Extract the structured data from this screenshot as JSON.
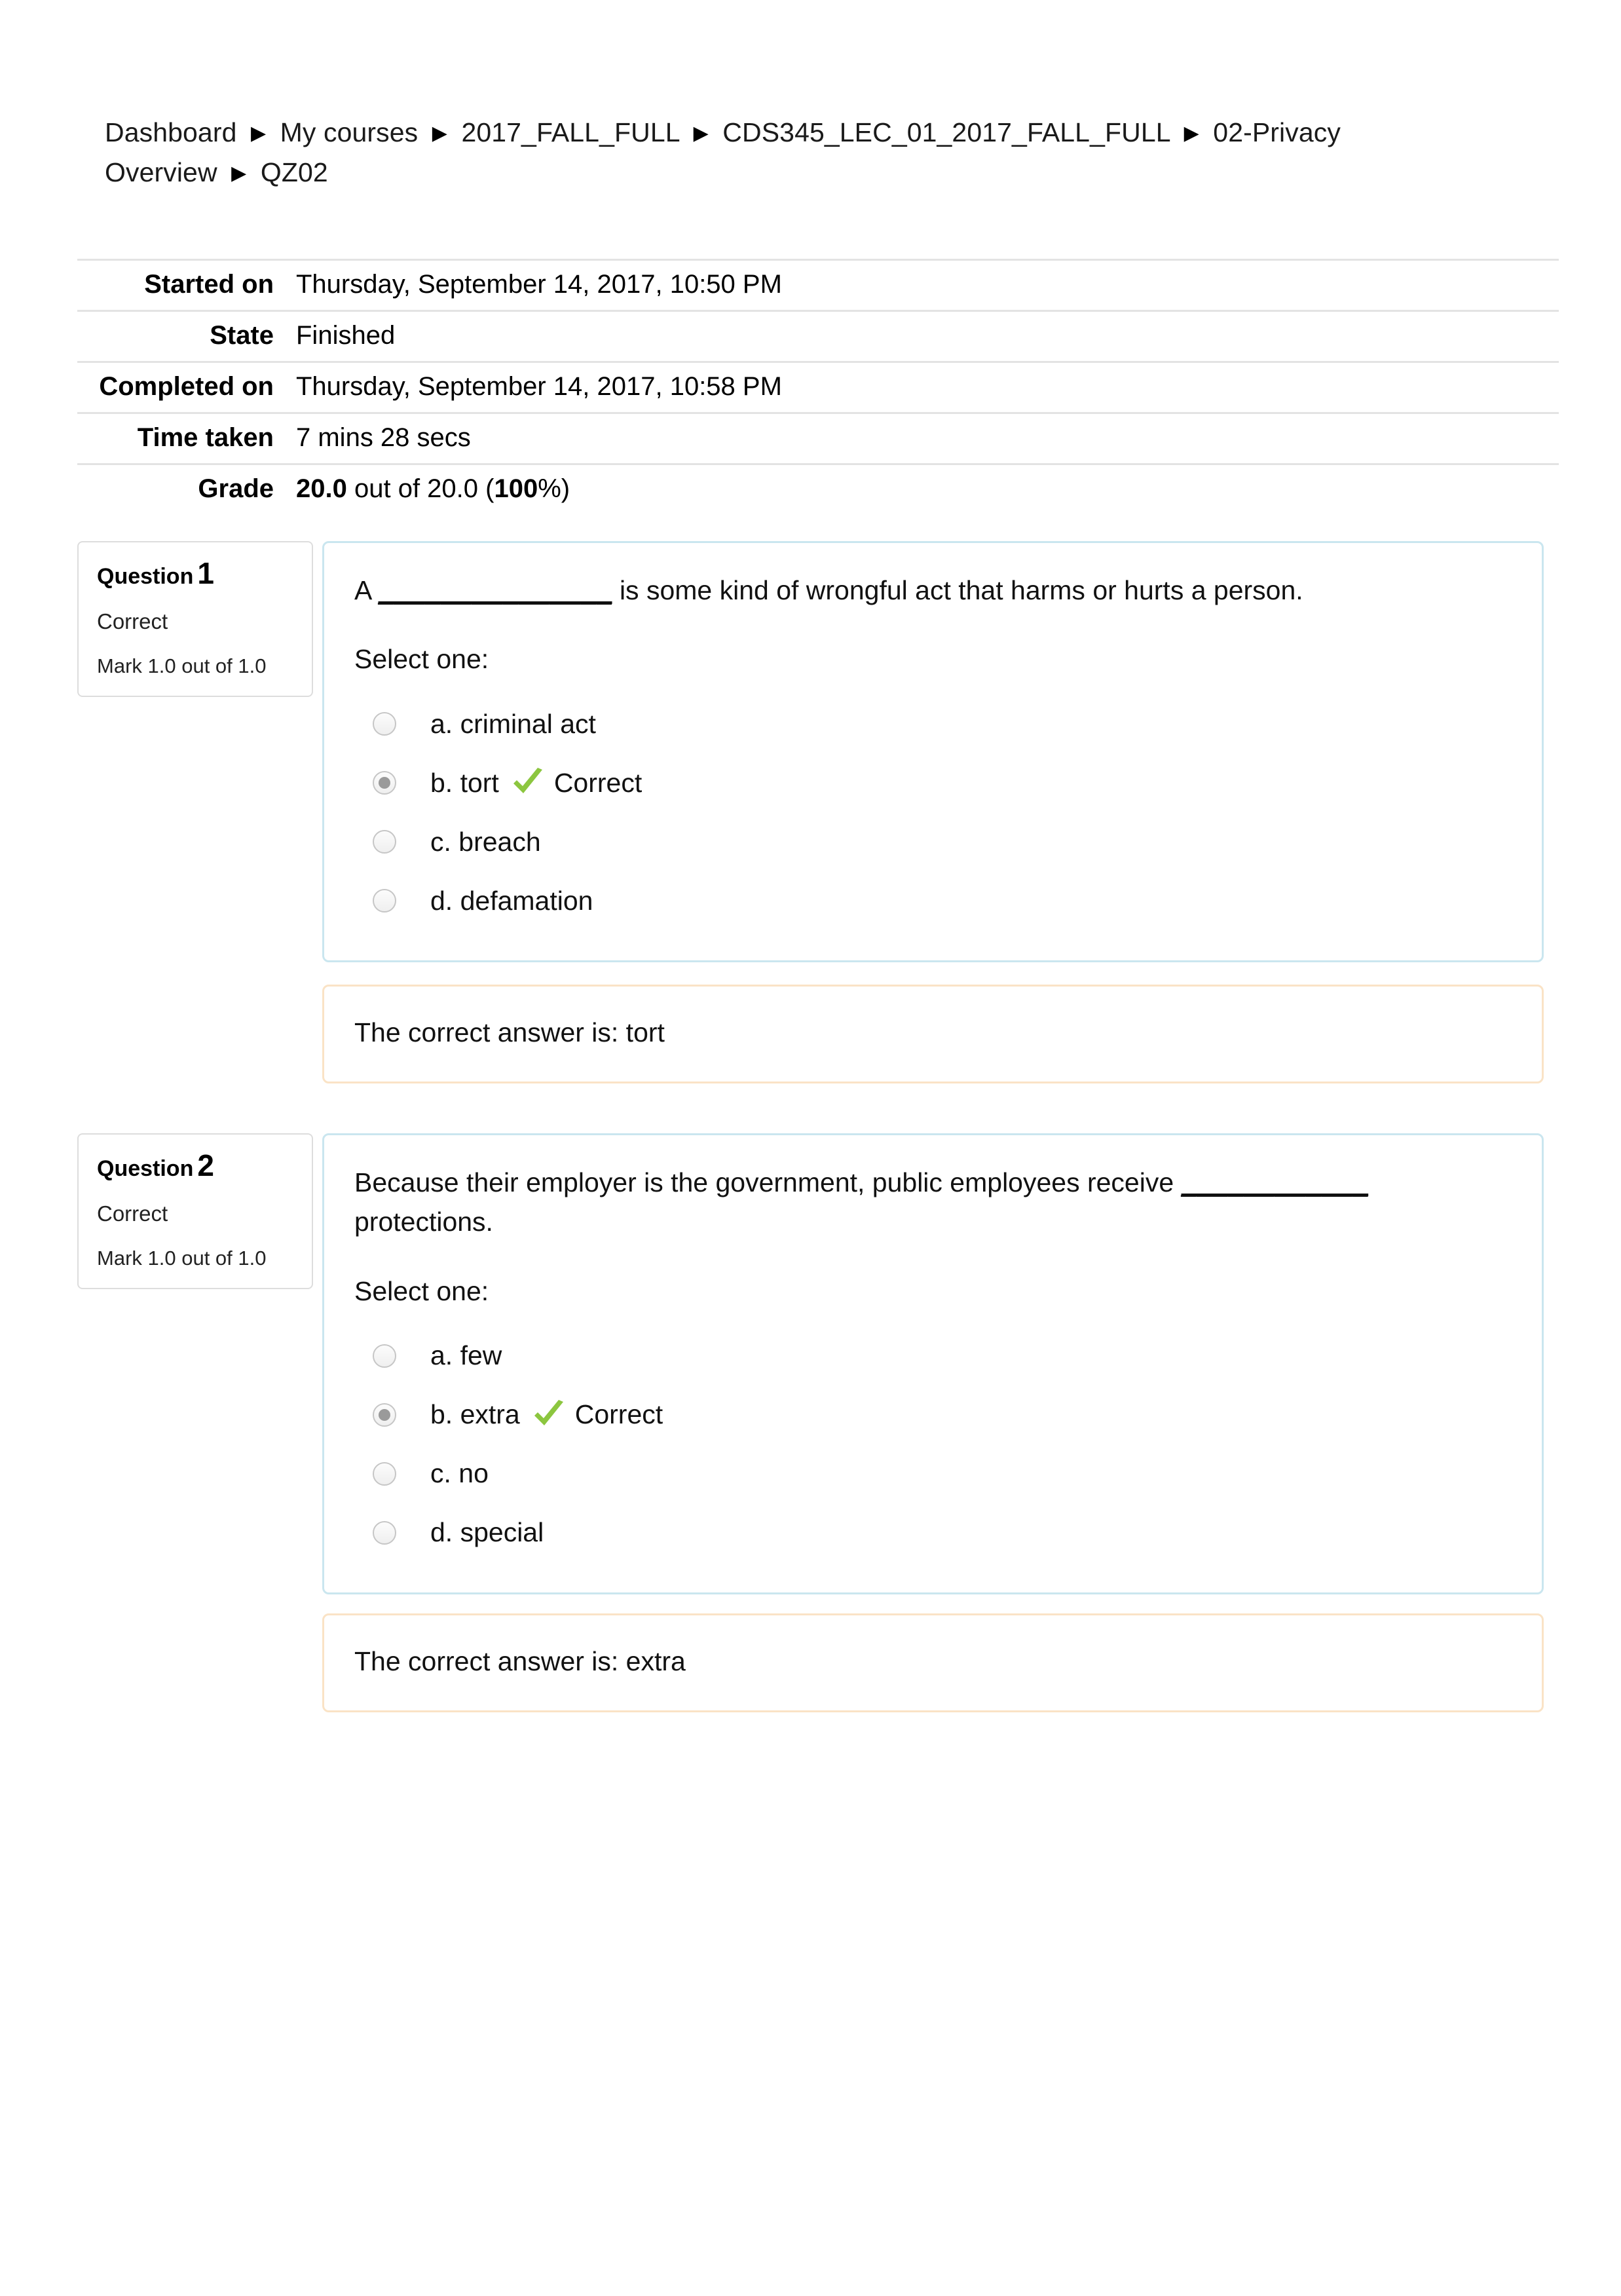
{
  "breadcrumb": {
    "separator": "▶",
    "items": [
      "Dashboard",
      "My courses",
      "2017_FALL_FULL",
      "CDS345_LEC_01_2017_FALL_FULL",
      "02-Privacy Overview",
      "QZ02"
    ]
  },
  "summary": {
    "rows": [
      {
        "label": "Started on",
        "value": "Thursday, September 14, 2017, 10:50 PM"
      },
      {
        "label": "State",
        "value": "Finished"
      },
      {
        "label": "Completed on",
        "value": "Thursday, September 14, 2017, 10:58 PM"
      },
      {
        "label": "Time taken",
        "value": "7 mins 28 secs"
      }
    ],
    "grade": {
      "label": "Grade",
      "score": "20.0",
      "middle": " out of 20.0 (",
      "percent": "100",
      "suffix": "%)"
    }
  },
  "questions": [
    {
      "number_label": "Question",
      "number": "1",
      "state": "Correct",
      "mark": "Mark 1.0 out of 1.0",
      "text_before": "A",
      "blank": "_______________",
      "text_after": "is some kind of wrongful act that harms or hurts a person.",
      "select_one": "Select one:",
      "options": [
        {
          "label": "a. criminal act",
          "selected": false,
          "verdict": ""
        },
        {
          "label": "b. tort",
          "selected": true,
          "verdict": "Correct"
        },
        {
          "label": "c. breach",
          "selected": false,
          "verdict": ""
        },
        {
          "label": "d. defamation",
          "selected": false,
          "verdict": ""
        }
      ],
      "feedback": "The correct answer is: tort"
    },
    {
      "number_label": "Question",
      "number": "2",
      "state": "Correct",
      "mark": "Mark 1.0 out of 1.0",
      "text_before": "Because their employer is the government, public employees receive",
      "blank": "____________",
      "text_after": "protections.",
      "select_one": "Select one:",
      "options": [
        {
          "label": "a. few",
          "selected": false,
          "verdict": ""
        },
        {
          "label": "b. extra",
          "selected": true,
          "verdict": "Correct"
        },
        {
          "label": "c. no",
          "selected": false,
          "verdict": ""
        },
        {
          "label": "d. special",
          "selected": false,
          "verdict": ""
        }
      ],
      "feedback": "The correct answer is: extra"
    }
  ],
  "colors": {
    "question_border": "#cae6ef",
    "feedback_border": "#fae3c6",
    "info_border": "#dddddd",
    "check_green": "#8cc63f",
    "divider": "#e3e3e3"
  },
  "icons": {
    "check": "check-icon",
    "breadcrumb_arrow": "triangle-right-icon"
  }
}
